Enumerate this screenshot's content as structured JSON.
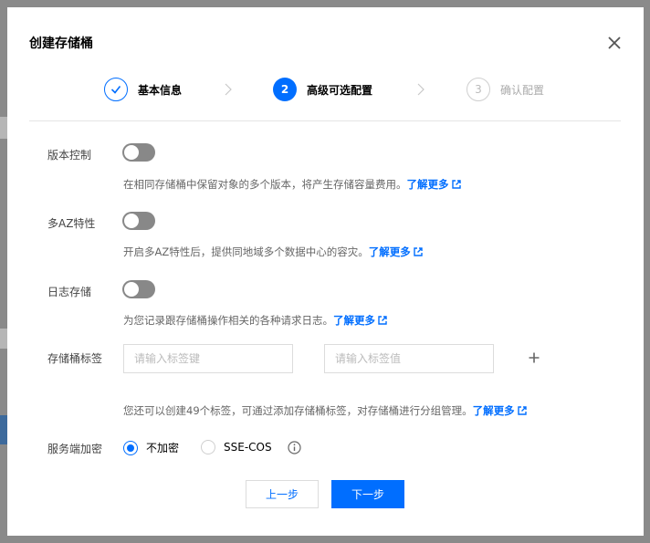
{
  "modal": {
    "title": "创建存储桶"
  },
  "steps": [
    {
      "number": "1",
      "label": "基本信息",
      "state": "done"
    },
    {
      "number": "2",
      "label": "高级可选配置",
      "state": "active"
    },
    {
      "number": "3",
      "label": "确认配置",
      "state": "todo"
    }
  ],
  "versioning": {
    "label": "版本控制",
    "enabled": false,
    "description": "在相同存储桶中保留对象的多个版本，将产生存储容量费用。",
    "link": "了解更多"
  },
  "multi_az": {
    "label": "多AZ特性",
    "enabled": false,
    "description": "开启多AZ特性后，提供同地域多个数据中心的容灾。",
    "link": "了解更多"
  },
  "logging": {
    "label": "日志存储",
    "enabled": false,
    "description": "为您记录跟存储桶操作相关的各种请求日志。",
    "link": "了解更多"
  },
  "tags": {
    "label": "存储桶标签",
    "key_placeholder": "请输入标签键",
    "value_placeholder": "请输入标签值",
    "key_value": "",
    "value_value": "",
    "hint": "您还可以创建49个标签，可通过添加存储桶标签，对存储桶进行分组管理。",
    "link": "了解更多"
  },
  "encryption": {
    "label": "服务端加密",
    "options": [
      "不加密",
      "SSE-COS"
    ],
    "selected": "不加密"
  },
  "buttons": {
    "prev": "上一步",
    "next": "下一步"
  },
  "colors": {
    "primary": "#006eff",
    "toggle_off": "#888888"
  },
  "icons": {
    "close": "close-icon",
    "check": "check-icon",
    "step_arrow": "chevron-right-icon",
    "external_link": "external-link-icon",
    "add": "plus-icon",
    "info": "info-icon"
  }
}
